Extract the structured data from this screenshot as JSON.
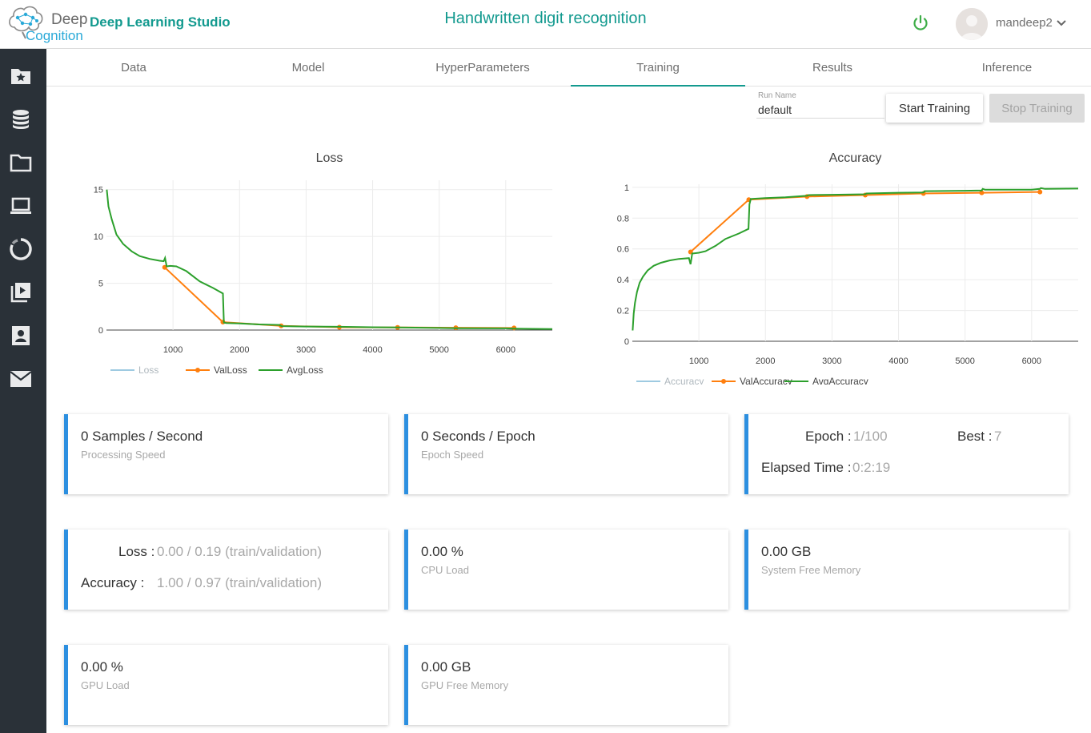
{
  "header": {
    "logo_word1": "Deep",
    "logo_word2": "Cognition",
    "brand": "Deep Learning Studio",
    "project_title": "Handwritten digit recognition",
    "username": "mandeep2",
    "power_icon": "power-icon",
    "chevron_icon": "chevron-down-icon"
  },
  "sidebar": {
    "items": [
      {
        "icon": "folder-star-icon"
      },
      {
        "icon": "database-icon"
      },
      {
        "icon": "folder-icon"
      },
      {
        "icon": "laptop-icon"
      },
      {
        "icon": "circle-progress-icon"
      },
      {
        "icon": "video-library-icon"
      },
      {
        "icon": "contact-card-icon"
      },
      {
        "icon": "mail-icon"
      }
    ]
  },
  "tabs": [
    {
      "label": "Data",
      "active": false
    },
    {
      "label": "Model",
      "active": false
    },
    {
      "label": "HyperParameters",
      "active": false
    },
    {
      "label": "Training",
      "active": true
    },
    {
      "label": "Results",
      "active": false
    },
    {
      "label": "Inference",
      "active": false
    }
  ],
  "run": {
    "label": "Run Name",
    "value": "default",
    "start_label": "Start Training",
    "stop_label": "Stop Training"
  },
  "chart_data": [
    {
      "type": "line",
      "title": "Loss",
      "xlim": [
        0,
        6700
      ],
      "ylim": [
        0,
        16
      ],
      "xticks": [
        1000,
        2000,
        3000,
        4000,
        5000,
        6000
      ],
      "yticks": [
        0,
        5,
        10,
        15
      ],
      "grid": true,
      "legend": "bottom",
      "series": [
        {
          "name": "Loss",
          "color": "#9ecae1",
          "markers": false,
          "points": []
        },
        {
          "name": "ValLoss",
          "color": "#ff7f0e",
          "markers": true,
          "points": [
            [
              875,
              6.7
            ],
            [
              1750,
              0.85
            ],
            [
              2625,
              0.45
            ],
            [
              3500,
              0.3
            ],
            [
              4375,
              0.28
            ],
            [
              5250,
              0.25
            ],
            [
              6125,
              0.22
            ]
          ]
        },
        {
          "name": "AvgLoss",
          "color": "#2ca02c",
          "markers": false,
          "points": [
            [
              5,
              15
            ],
            [
              30,
              13.2
            ],
            [
              80,
              11.8
            ],
            [
              150,
              10.2
            ],
            [
              250,
              9.2
            ],
            [
              380,
              8.4
            ],
            [
              500,
              7.9
            ],
            [
              650,
              7.6
            ],
            [
              800,
              7.4
            ],
            [
              860,
              7.35
            ],
            [
              880,
              7.7
            ],
            [
              905,
              6.8
            ],
            [
              960,
              6.85
            ],
            [
              1050,
              6.8
            ],
            [
              1200,
              6.3
            ],
            [
              1400,
              5.2
            ],
            [
              1600,
              4.5
            ],
            [
              1750,
              3.9
            ],
            [
              1765,
              0.8
            ],
            [
              1800,
              0.75
            ],
            [
              2000,
              0.7
            ],
            [
              2300,
              0.6
            ],
            [
              2600,
              0.55
            ],
            [
              2630,
              0.42
            ],
            [
              3000,
              0.38
            ],
            [
              3500,
              0.35
            ],
            [
              4000,
              0.3
            ],
            [
              4375,
              0.28
            ],
            [
              5000,
              0.22
            ],
            [
              5250,
              0.2
            ],
            [
              6000,
              0.18
            ],
            [
              6125,
              0.15
            ],
            [
              6700,
              0.1
            ]
          ]
        }
      ]
    },
    {
      "type": "line",
      "title": "Accuracy",
      "xlim": [
        0,
        6700
      ],
      "ylim": [
        0,
        1.02
      ],
      "xticks": [
        1000,
        2000,
        3000,
        4000,
        5000,
        6000
      ],
      "yticks": [
        0,
        0.2,
        0.4,
        0.6,
        0.8,
        1
      ],
      "grid": true,
      "legend": "bottom",
      "series": [
        {
          "name": "Accuracy",
          "color": "#9ecae1",
          "markers": false,
          "points": []
        },
        {
          "name": "ValAccuracy",
          "color": "#ff7f0e",
          "markers": true,
          "points": [
            [
              875,
              0.58
            ],
            [
              1750,
              0.92
            ],
            [
              2625,
              0.94
            ],
            [
              3500,
              0.95
            ],
            [
              4375,
              0.96
            ],
            [
              5250,
              0.965
            ],
            [
              6125,
              0.97
            ]
          ]
        },
        {
          "name": "AvgAccuracy",
          "color": "#2ca02c",
          "markers": false,
          "points": [
            [
              5,
              0.07
            ],
            [
              20,
              0.18
            ],
            [
              40,
              0.25
            ],
            [
              70,
              0.32
            ],
            [
              110,
              0.38
            ],
            [
              160,
              0.42
            ],
            [
              230,
              0.46
            ],
            [
              320,
              0.49
            ],
            [
              430,
              0.51
            ],
            [
              560,
              0.525
            ],
            [
              700,
              0.535
            ],
            [
              850,
              0.54
            ],
            [
              875,
              0.5
            ],
            [
              900,
              0.57
            ],
            [
              1000,
              0.575
            ],
            [
              1100,
              0.585
            ],
            [
              1250,
              0.62
            ],
            [
              1400,
              0.665
            ],
            [
              1600,
              0.7
            ],
            [
              1745,
              0.73
            ],
            [
              1760,
              0.89
            ],
            [
              1780,
              0.925
            ],
            [
              2000,
              0.93
            ],
            [
              2300,
              0.935
            ],
            [
              2625,
              0.945
            ],
            [
              2650,
              0.95
            ],
            [
              3000,
              0.952
            ],
            [
              3500,
              0.955
            ],
            [
              3520,
              0.96
            ],
            [
              4000,
              0.965
            ],
            [
              4375,
              0.967
            ],
            [
              4390,
              0.975
            ],
            [
              5000,
              0.978
            ],
            [
              5250,
              0.98
            ],
            [
              5265,
              0.99
            ],
            [
              5300,
              0.985
            ],
            [
              6000,
              0.985
            ],
            [
              6125,
              0.99
            ],
            [
              6140,
              0.995
            ],
            [
              6200,
              0.99
            ],
            [
              6700,
              0.992
            ]
          ]
        }
      ]
    }
  ],
  "cards": {
    "samples": {
      "main": "0 Samples / Second",
      "sub": "Processing Speed"
    },
    "epoch_speed": {
      "main": "0 Seconds / Epoch",
      "sub": "Epoch Speed"
    },
    "epoch": {
      "epoch_label": "Epoch :",
      "epoch_value": "1/100",
      "best_label": "Best :",
      "best_value": "7",
      "elapsed_label": "Elapsed Time :",
      "elapsed_value": "0:2:19"
    },
    "metrics": {
      "loss_label": "Loss :",
      "loss_value": "0.00 / 0.19 (train/validation)",
      "acc_label": "Accuracy :",
      "acc_value": "1.00 / 0.97 (train/validation)"
    },
    "cpu": {
      "main": "0.00 %",
      "sub": "CPU Load"
    },
    "sysmem": {
      "main": "0.00 GB",
      "sub": "System Free Memory"
    },
    "gpu": {
      "main": "0.00 %",
      "sub": "GPU Load"
    },
    "gpumem": {
      "main": "0.00 GB",
      "sub": "GPU Free Memory"
    }
  }
}
